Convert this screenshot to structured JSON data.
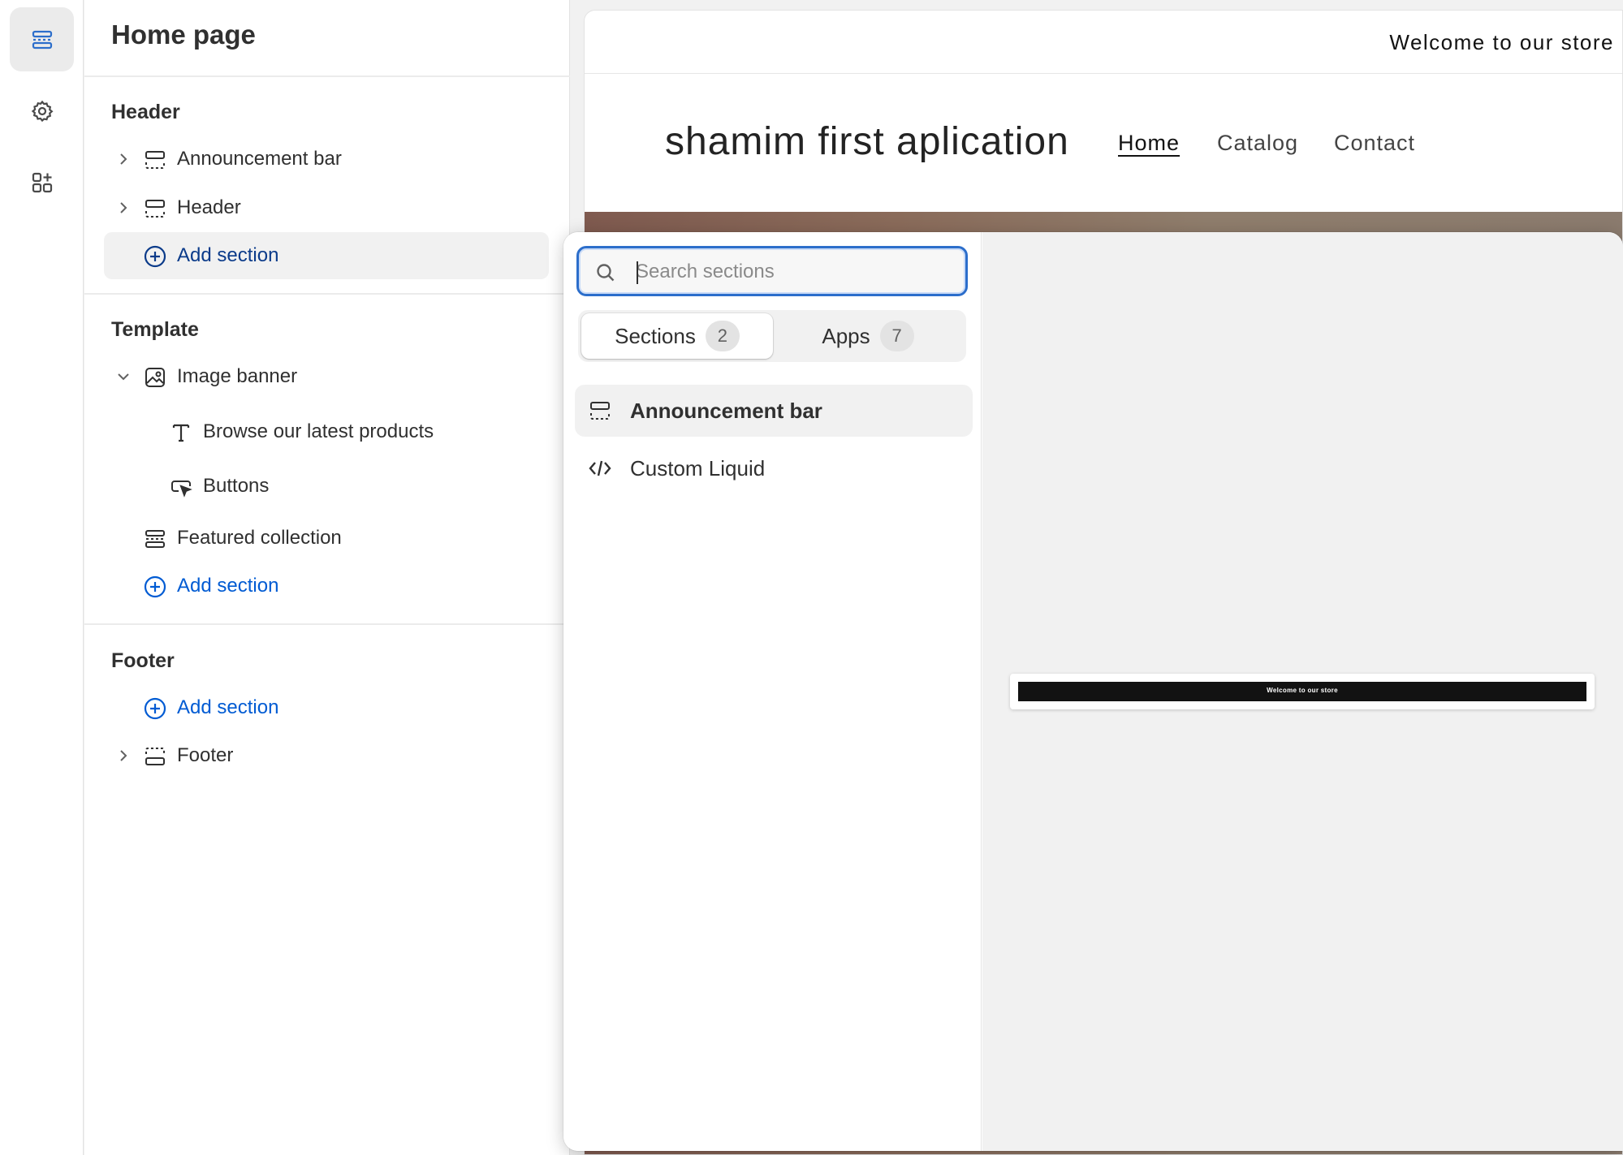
{
  "rail": {
    "items": [
      {
        "name": "sections",
        "icon": "sections-icon",
        "active": true
      },
      {
        "name": "settings",
        "icon": "gear-icon",
        "active": false
      },
      {
        "name": "apps",
        "icon": "apps-icon",
        "active": false
      }
    ]
  },
  "sidebar": {
    "title": "Home page",
    "header_group": {
      "title": "Header",
      "items": [
        {
          "label": "Announcement bar",
          "icon": "section-icon",
          "expandable": true
        },
        {
          "label": "Header",
          "icon": "section-icon",
          "expandable": true
        }
      ],
      "add_section": "Add section"
    },
    "template_group": {
      "title": "Template",
      "image_banner": {
        "label": "Image banner",
        "icon": "image-icon",
        "expanded": true
      },
      "blocks": [
        {
          "label": "Browse our latest products",
          "icon": "text-icon"
        },
        {
          "label": "Buttons",
          "icon": "button-icon"
        }
      ],
      "featured": {
        "label": "Featured collection",
        "icon": "section-icon"
      },
      "add_section": "Add section"
    },
    "footer_group": {
      "title": "Footer",
      "add_section": "Add section",
      "footer": {
        "label": "Footer",
        "icon": "footer-icon",
        "expandable": true
      }
    }
  },
  "preview": {
    "announcement": "Welcome to our store",
    "store_name": "shamim first aplication",
    "nav": [
      "Home",
      "Catalog",
      "Contact"
    ],
    "active_nav": "Home"
  },
  "picker": {
    "search_placeholder": "Search sections",
    "search_value": "",
    "tabs": [
      {
        "label": "Sections",
        "count": "2",
        "active": true
      },
      {
        "label": "Apps",
        "count": "7",
        "active": false
      }
    ],
    "items": [
      {
        "label": "Announcement bar",
        "icon": "section-icon",
        "highlighted": true
      },
      {
        "label": "Custom Liquid",
        "icon": "code-icon",
        "highlighted": false
      }
    ],
    "preview_thumbnail_text": "Welcome to our store"
  },
  "colors": {
    "accent": "#005bd3",
    "focus_ring": "#2c6ecb",
    "text": "#303030",
    "surface": "#f1f1f1"
  }
}
